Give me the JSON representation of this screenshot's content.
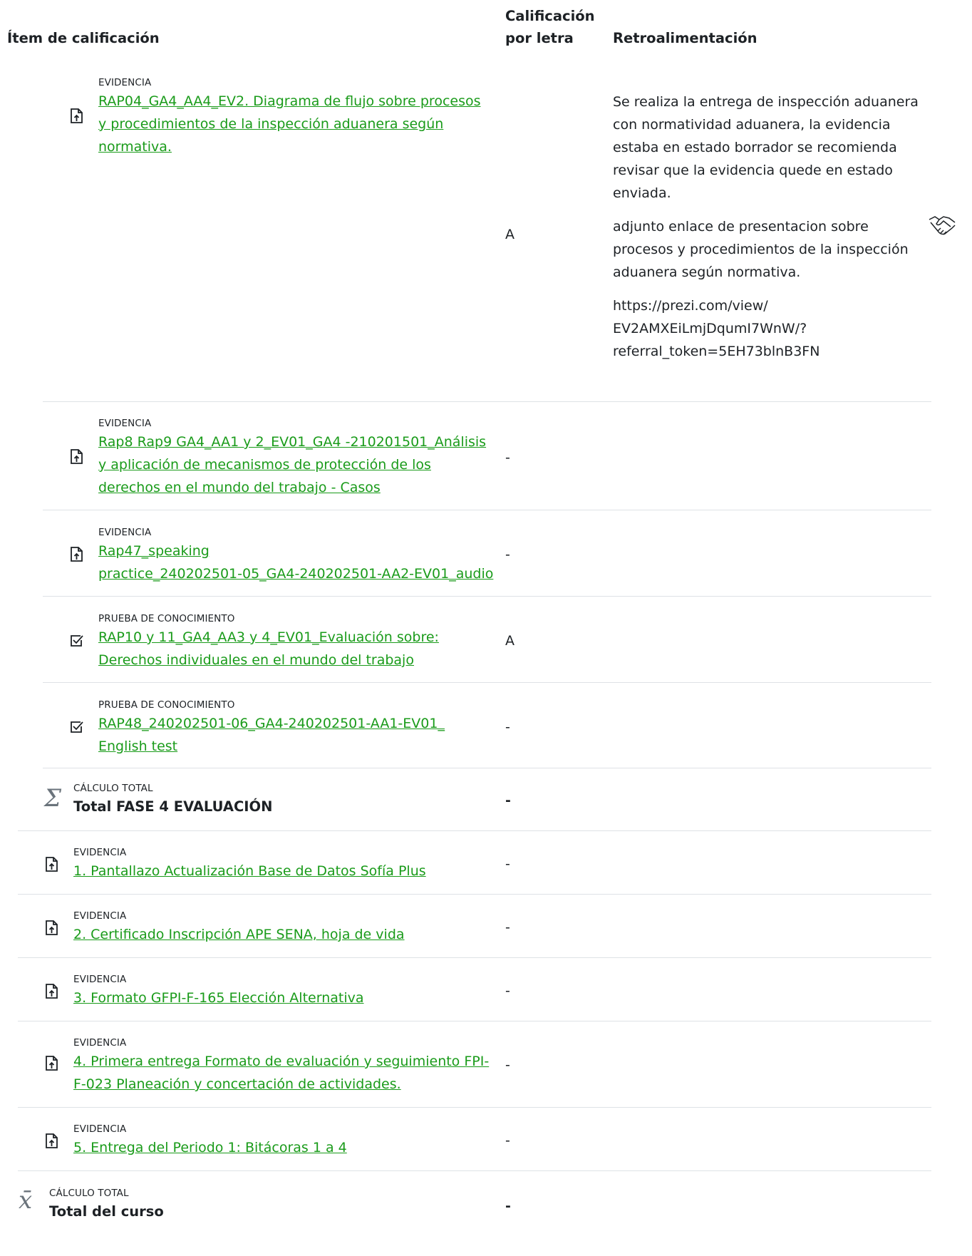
{
  "headers": {
    "item": "Ítem de calificación",
    "letter_line1": "Calificación",
    "letter_line2": "por letra",
    "feedback": "Retroalimentación"
  },
  "rows": [
    {
      "type": "EVIDENCIA",
      "lines": [
        "RAP04_GA4_AA4_EV2. Diagrama de flujo sobre procesos",
        "y procedimientos de la inspección aduanera según",
        "normativa."
      ],
      "grade": "A",
      "feedback": [
        "Se realiza la entrega de inspección aduanera con normatividad aduanera, la evidencia estaba en estado borrador se recomienda revisar que la evidencia quede en estado enviada.",
        "adjunto enlace de presentacion sobre procesos y procedimientos de la inspección aduanera según normativa.",
        "https://prezi.com/view/ EV2AMXEiLmjDqumI7WnW/? referral_token=5EH73blnB3FN"
      ]
    },
    {
      "type": "EVIDENCIA",
      "lines": [
        "Rap8 Rap9 GA4_AA1 y 2_EV01_GA4 -210201501_Análisis",
        "y aplicación de mecanismos de protección de los",
        "derechos en el mundo del trabajo - Casos"
      ],
      "grade": "-"
    },
    {
      "type": "EVIDENCIA",
      "lines": [
        "Rap47_speaking",
        "practice_240202501-05_GA4-240202501-AA2-EV01_audio"
      ],
      "grade": "-"
    },
    {
      "type": "PRUEBA DE CONOCIMIENTO",
      "lines": [
        "RAP10 y 11_GA4_AA3 y 4_EV01_Evaluación sobre:",
        "Derechos individuales en el mundo del trabajo"
      ],
      "grade": "A"
    },
    {
      "type": "PRUEBA DE CONOCIMIENTO",
      "lines": [
        "RAP48_240202501-06_GA4-240202501-AA1-EV01_",
        "English test"
      ],
      "grade": "-"
    },
    {
      "type": "EVIDENCIA",
      "lines": [
        "1. Pantallazo Actualización Base de Datos Sofía Plus"
      ],
      "grade": "-"
    },
    {
      "type": "EVIDENCIA",
      "lines": [
        "2. Certificado Inscripción APE SENA, hoja de vida"
      ],
      "grade": "-"
    },
    {
      "type": "EVIDENCIA",
      "lines": [
        "3. Formato GFPI-F-165 Elección Alternativa"
      ],
      "grade": "-"
    },
    {
      "type": "EVIDENCIA",
      "lines": [
        "4. Primera entrega Formato de evaluación y seguimiento FPI-",
        "F-023 Planeación y concertación de actividades."
      ],
      "grade": "-"
    },
    {
      "type": "EVIDENCIA",
      "lines": [
        "5. Entrega del Periodo 1: Bitácoras 1 a 4"
      ],
      "grade": "-"
    }
  ],
  "totals": [
    {
      "type": "CÁLCULO TOTAL",
      "title": "Total FASE 4 EVALUACIÓN",
      "grade": "-",
      "icon": "sigma-icon",
      "glyph": "Σ"
    },
    {
      "type": "CÁLCULO TOTAL",
      "title": "Total del curso",
      "grade": "-",
      "icon": "mean-icon",
      "glyph": "x̄"
    }
  ],
  "colors": {
    "link": "#1a9b1a",
    "separator": "#dee2e6",
    "text": "#1d2125"
  },
  "icons": {
    "evidence": "file-upload-icon",
    "quiz": "checkbox-icon",
    "feedback_extra": "handshake-icon"
  }
}
